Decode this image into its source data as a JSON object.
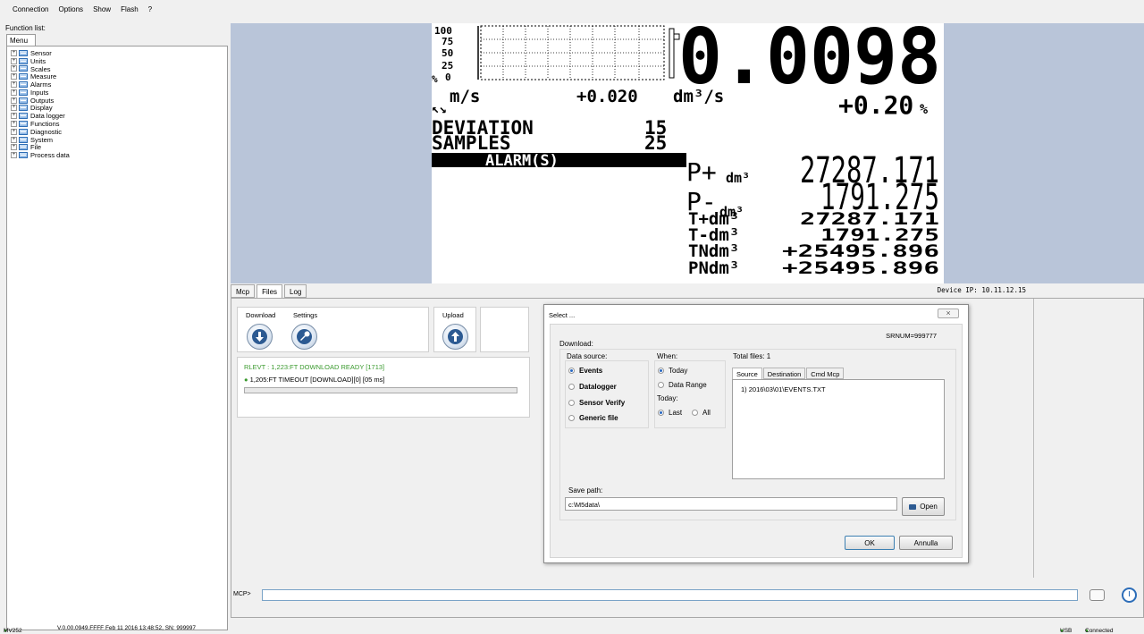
{
  "menubar": [
    "Connection",
    "Options",
    "Show",
    "Flash",
    "?"
  ],
  "function_panel": {
    "label": "Function list:",
    "tab": "Menu",
    "items": [
      "Sensor",
      "Units",
      "Scales",
      "Measure",
      "Alarms",
      "Inputs",
      "Outputs",
      "Display",
      "Data logger",
      "Functions",
      "Diagnostic",
      "System",
      "File",
      "Process data"
    ]
  },
  "lcd": {
    "bar_ticks": [
      "100",
      "75",
      "50",
      "25",
      "0"
    ],
    "bar_unit": "%",
    "flow_value": "0.0098",
    "unit_left": "m/s",
    "velocity": "+0.020",
    "flow_unit": "dm³/s",
    "percent": "+0.20",
    "percent_sign": "%",
    "deviation_label": "DEVIATION",
    "deviation_value": "15",
    "samples_label": "SAMPLES",
    "samples_value": "25",
    "alarm_banner": "ALARM(S)",
    "totals": [
      {
        "label": "P+",
        "unit": "dm³",
        "value": "27287.171"
      },
      {
        "label": "P-",
        "unit": "dm³",
        "value": "1791.275"
      }
    ],
    "small_totals": [
      {
        "label": "T+dm³",
        "value": "27287.171"
      },
      {
        "label": "T-dm³",
        "value": "1791.275"
      },
      {
        "label": "TNdm³",
        "value": "+25495.896"
      },
      {
        "label": "PNdm³",
        "value": "+25495.896"
      }
    ]
  },
  "device_ip": "Device IP: 10.11.12.15",
  "tabs": [
    "Mcp",
    "Files",
    "Log"
  ],
  "active_tab": "Files",
  "files_panel": {
    "download_label": "Download",
    "settings_label": "Settings",
    "upload_label": "Upload",
    "log_line1": "RLEVT : 1,223:FT DOWNLOAD READY [1713]",
    "log_line2": "1,205:FT TIMEOUT [DOWNLOAD][0] [05 ms]"
  },
  "mcp": {
    "prompt": "MCP>",
    "value": ""
  },
  "dialog": {
    "title": "Select ...",
    "srnum": "SRNUM=999777",
    "download_label": "Download:",
    "data_source_label": "Data source:",
    "data_sources": [
      {
        "label": "Events",
        "checked": true
      },
      {
        "label": "Datalogger",
        "checked": false
      },
      {
        "label": "Sensor Verify",
        "checked": false
      },
      {
        "label": "Generic file",
        "checked": false
      }
    ],
    "when_label": "When:",
    "when_options": [
      {
        "label": "Today",
        "checked": true
      },
      {
        "label": "Data Range",
        "checked": false
      }
    ],
    "today_label": "Today:",
    "today_options": [
      {
        "label": "Last",
        "checked": true
      },
      {
        "label": "All",
        "checked": false
      }
    ],
    "total_files": "Total files: 1",
    "file_tabs": [
      "Source",
      "Destination",
      "Cmd Mcp"
    ],
    "files": [
      "1) 2016\\03\\01\\EVENTS.TXT"
    ],
    "save_path_label": "Save path:",
    "save_path": "c:\\M5data\\",
    "open_label": "Open",
    "ok_label": "OK",
    "cancel_label": "Annulla"
  },
  "status": {
    "device": "MV252",
    "info": "V.0.00.0949.FFFF Feb 11 2016   13:48:52, SN: 999997",
    "usb": "USB",
    "connected": "Connected"
  }
}
